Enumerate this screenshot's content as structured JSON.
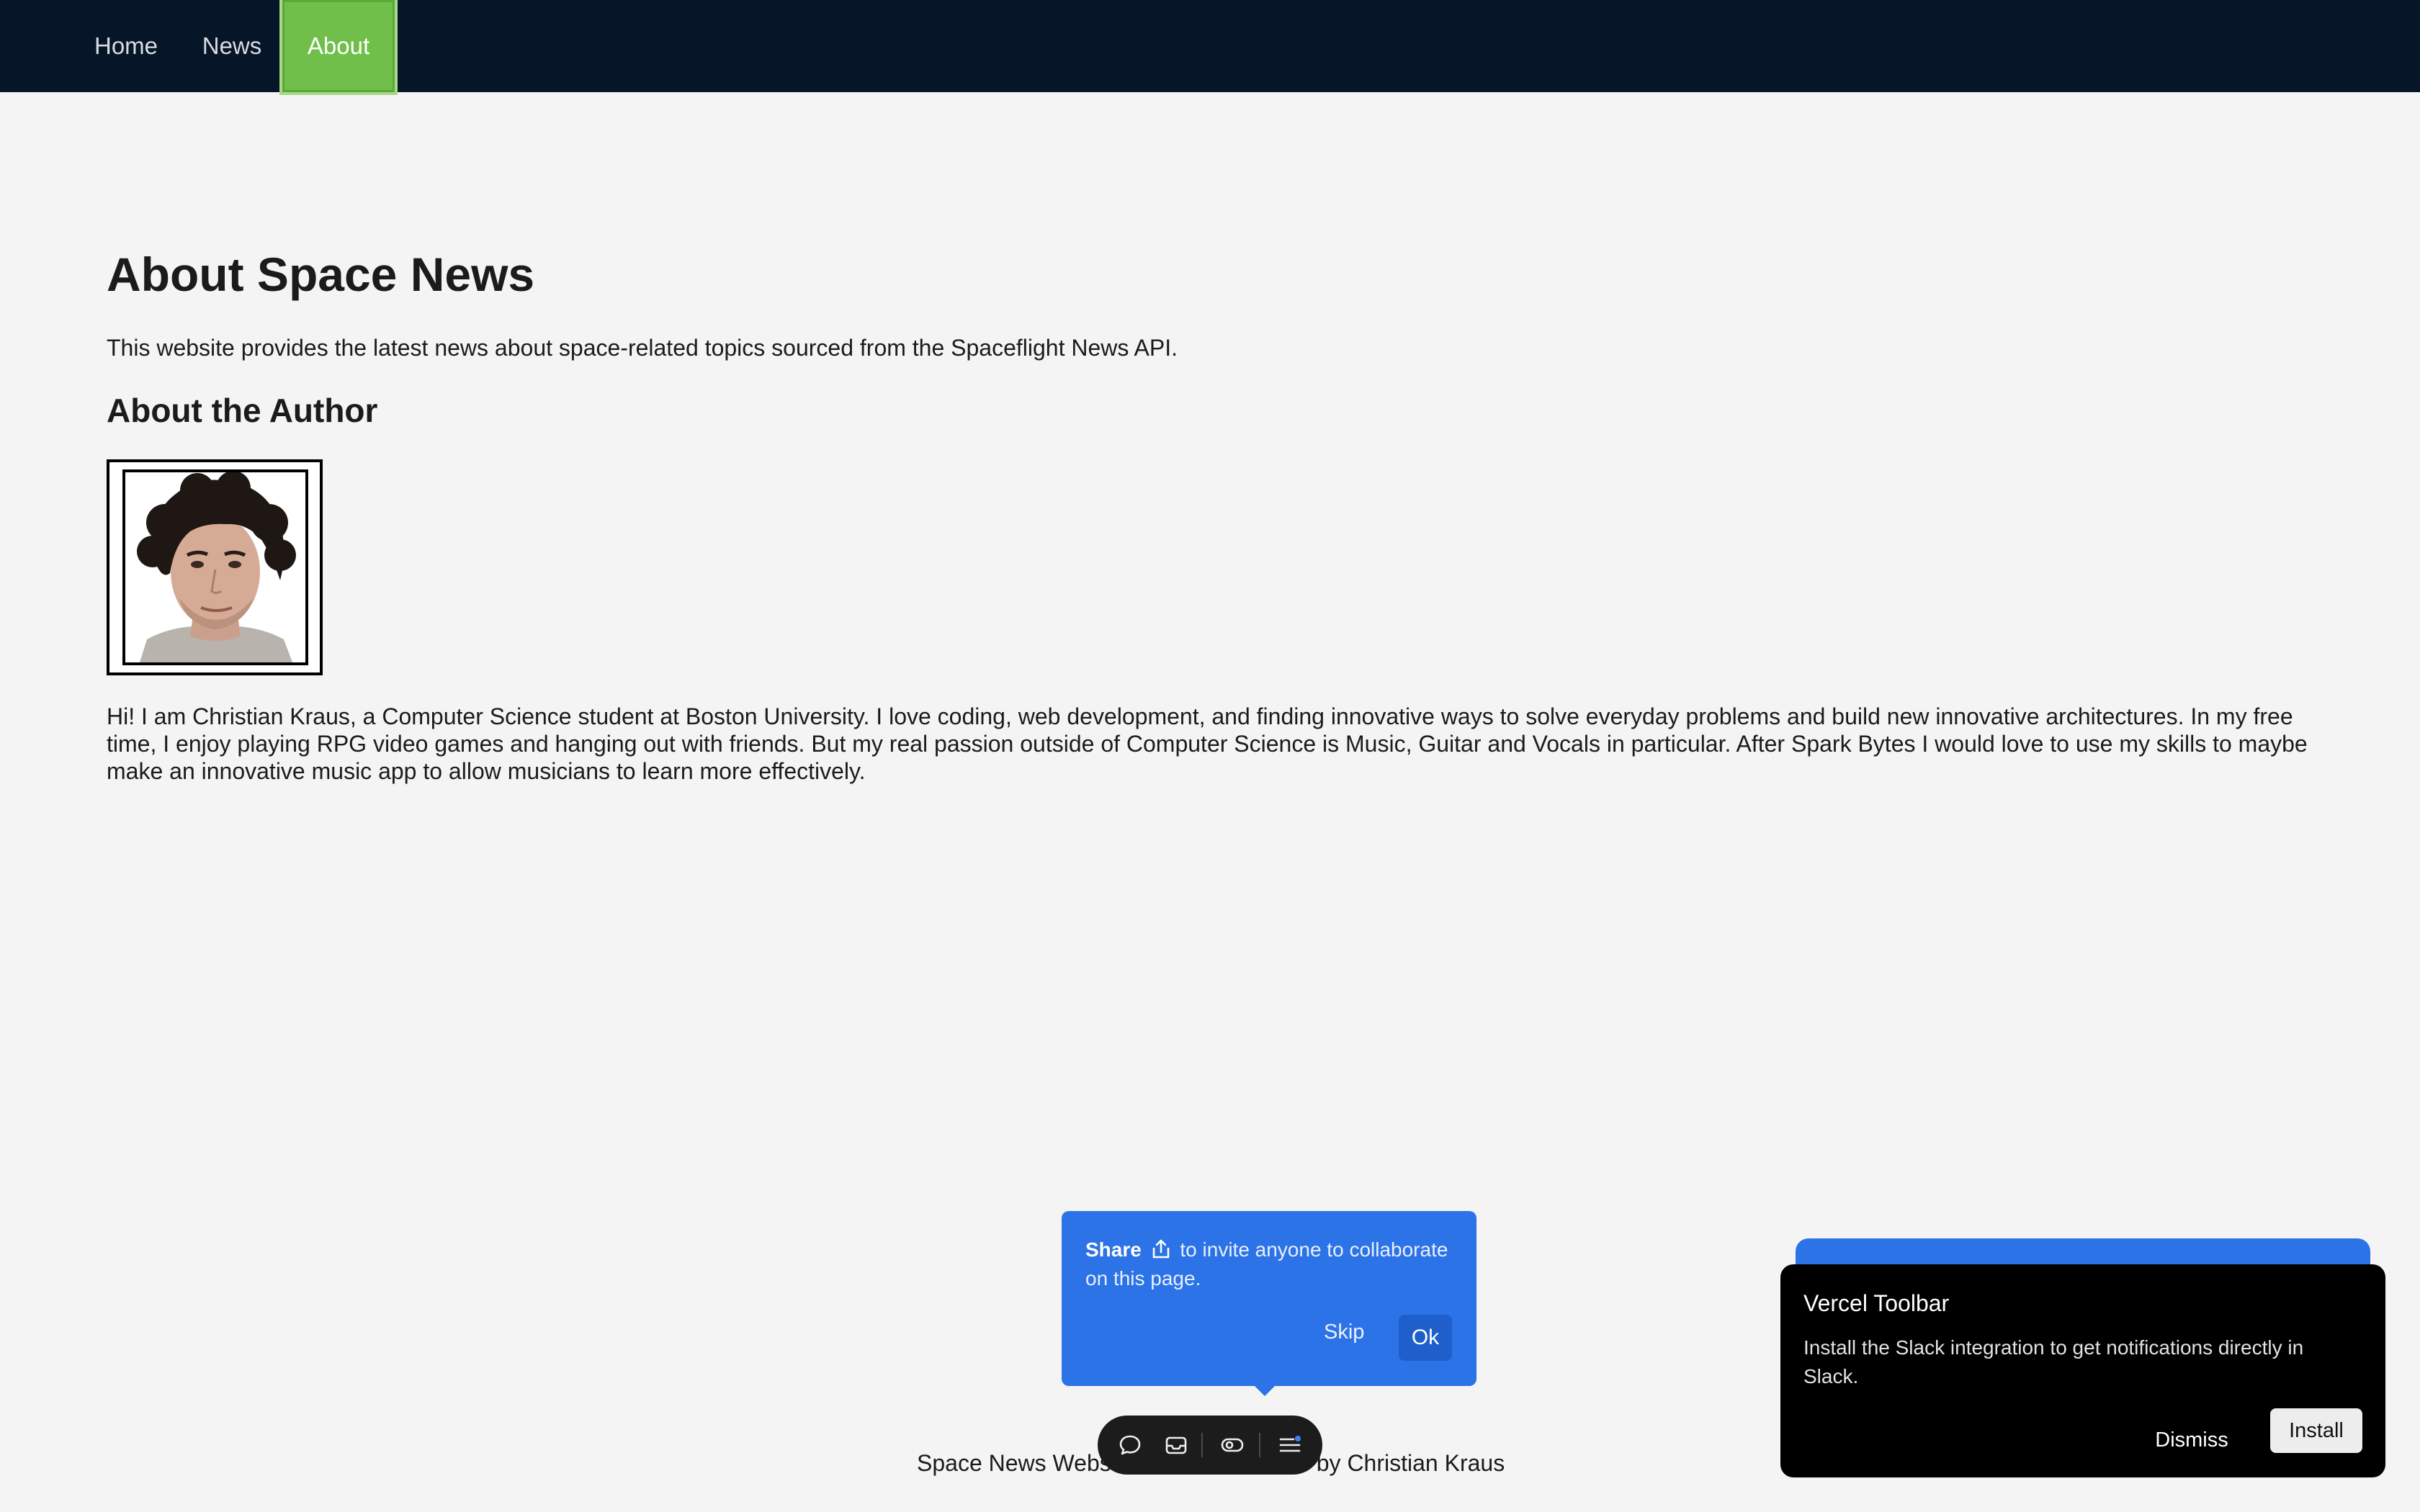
{
  "nav": {
    "items": [
      {
        "label": "Home"
      },
      {
        "label": "News"
      },
      {
        "label": "About"
      }
    ],
    "active": "About"
  },
  "main": {
    "title": "About Space News",
    "intro": "This website provides the latest news about space-related topics sourced from the Spaceflight News API.",
    "author_heading": "About the Author",
    "bio": "Hi! I am Christian Kraus, a Computer Science student at Boston University. I love coding, web development, and finding innovative ways to solve everyday problems and build new innovative architectures. In my free time, I enjoy playing RPG video games and hanging out with friends. But my real passion outside of Computer Science is Music, Guitar and Vocals in particular. After Spark Bytes I would love to use my skills to maybe make an innovative music app to allow musicians to learn more effectively."
  },
  "footer": {
    "text_start": "Space News Webs",
    "text_end": "by Christian Kraus"
  },
  "share_popup": {
    "bold": "Share",
    "message": "to invite anyone to collaborate on this page.",
    "skip_label": "Skip",
    "ok_label": "Ok",
    "icon": "share-icon"
  },
  "toolbar": {
    "icons": [
      "comment-icon",
      "inbox-icon",
      "eye-toggle-icon",
      "menu-icon"
    ]
  },
  "toast": {
    "title": "Vercel Toolbar",
    "body": "Install the Slack integration to get notifications directly in Slack.",
    "dismiss_label": "Dismiss",
    "install_label": "Install"
  },
  "colors": {
    "navbar_bg": "#061527",
    "active_tab": "#6fbf4a",
    "page_bg": "#f4f4f4",
    "popup_blue": "#2b73e6",
    "toast_bg": "#000000"
  }
}
